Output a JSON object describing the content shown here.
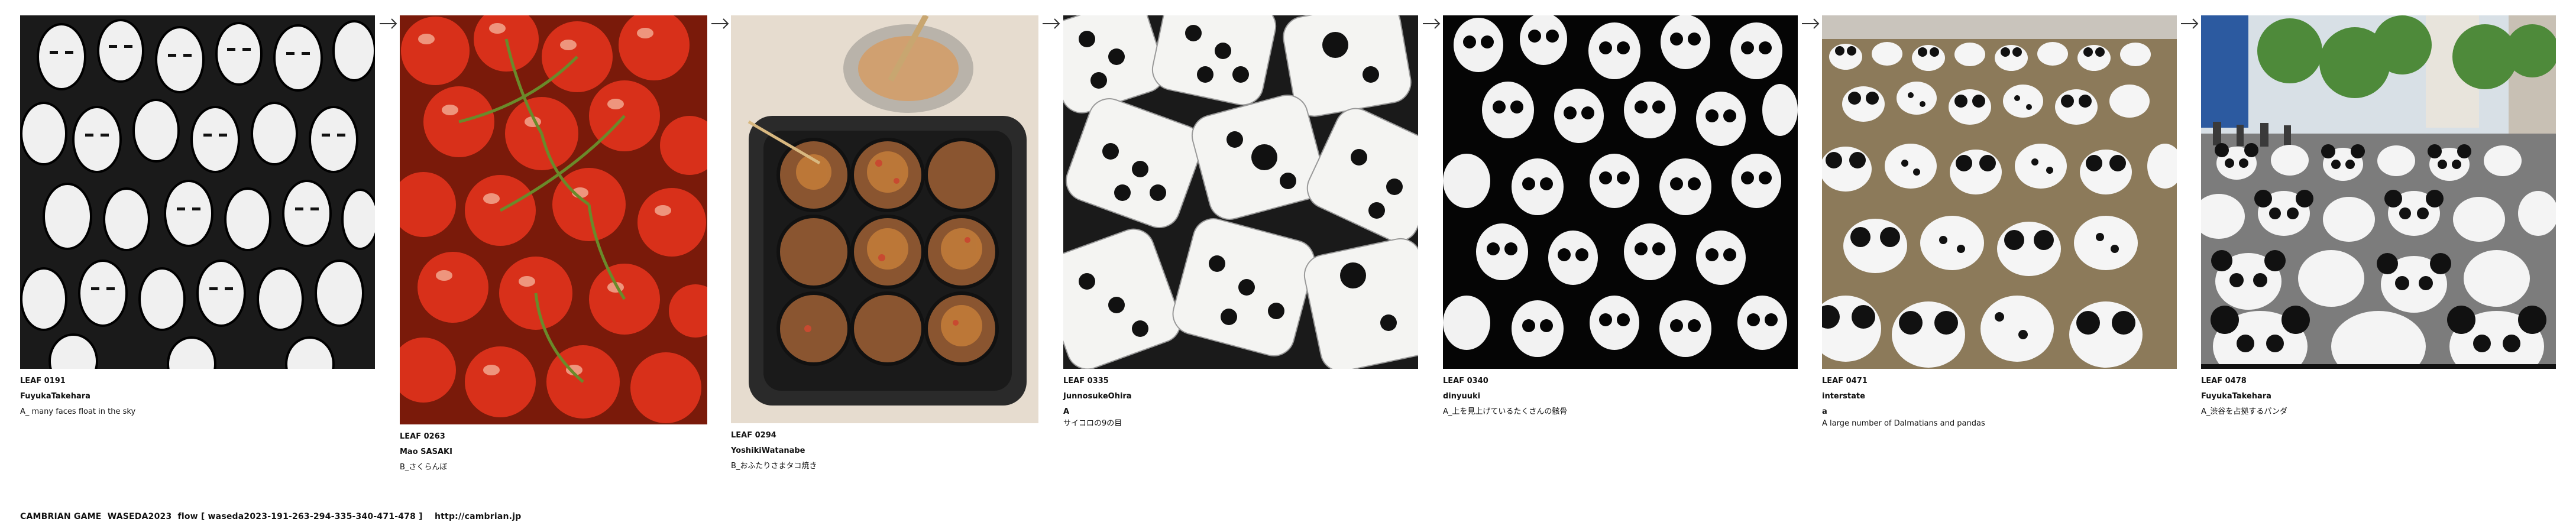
{
  "leaves": [
    {
      "id": "LEAF 0191",
      "author": "FuyukaTakehara",
      "note": "",
      "caption": "A_ many faces float in the sky"
    },
    {
      "id": "LEAF 0263",
      "author": "Mao SASAKI",
      "note": "",
      "caption": "B_さくらんぼ"
    },
    {
      "id": "LEAF 0294",
      "author": "YoshikiWatanabe",
      "note": "",
      "caption": "B_おふたりさまタコ焼き"
    },
    {
      "id": "LEAF 0335",
      "author": "JunnosukeOhira",
      "note": "A",
      "caption": "サイコロの9の目"
    },
    {
      "id": "LEAF 0340",
      "author": "dinyuuki",
      "note": "",
      "caption": "A_上を見上げているたくさんの骸骨"
    },
    {
      "id": "LEAF 0471",
      "author": "interstate",
      "note": "a",
      "caption": "A large number of Dalmatians and pandas"
    },
    {
      "id": "LEAF 0478",
      "author": "FuyukaTakehara",
      "note": "",
      "caption": "A_渋谷を占拠するパンダ"
    }
  ],
  "footer": {
    "game": "CAMBRIAN GAME  WASEDA2023  flow [ waseda2023-191-263-294-335-340-471-478 ]",
    "url": "http://cambrian.jp"
  }
}
